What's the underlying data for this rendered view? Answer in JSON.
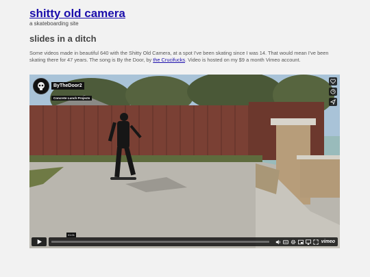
{
  "site": {
    "title": "shitty old camera",
    "tagline": "a skateboarding site"
  },
  "post": {
    "title": "slides in a ditch",
    "body_before_link": "Some videos made in beautiful 640 with the Shitty Old Camera, at a spot I've been skating since I was 14. That would mean I've been skating there for 47 years. The song is By the Door, by ",
    "link_text": "the Crucifucks",
    "body_after_link": ". Video is hosted on my $9 a month Vimeo account."
  },
  "player": {
    "channel": "ByTheDoor2",
    "subtitle": "Concrete Lunch Projects",
    "time": "01:01",
    "progress": 0.0,
    "brand": "vimeo",
    "icons": [
      "heart-icon",
      "clock-icon",
      "send-icon",
      "play-icon",
      "volume-icon",
      "captions-icon",
      "settings-icon",
      "pip-icon",
      "airplay-icon",
      "fullscreen-icon"
    ],
    "colors": {
      "accent": "#ffffff",
      "link": "#1a0dab"
    }
  }
}
